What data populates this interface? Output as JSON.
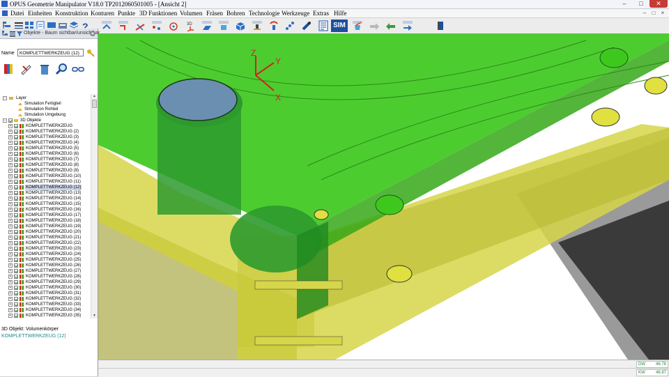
{
  "window": {
    "title": "OPUS Geometrie Manipulator V18.0   TP2012060501005   - [Ansicht 2]",
    "controls": [
      "–",
      "□",
      "✕"
    ]
  },
  "menu": {
    "items": [
      "Datei",
      "Einheiten",
      "Konstruktion",
      "Konturen",
      "Punkte",
      "3D Funktionen",
      "Volumen",
      "Fräsen",
      "Bohren",
      "Technologie",
      "Werkzeuge",
      "Extras",
      "Hilfe"
    ],
    "mdi_controls": [
      "–",
      "□",
      "×"
    ]
  },
  "toolbar": {
    "sim_label": "SIM"
  },
  "panel": {
    "header": "Objekte - Baum sichtbar/unsichtbar",
    "name_label": "Name",
    "name_value": "KOMPLETTWERKZEUG (12)"
  },
  "tree": {
    "layer_root": "Layer",
    "layers": [
      "Simulation Fertigteil",
      "Simulation Rohteil",
      "Simulation Umgebung"
    ],
    "objects_root": "3D Objekte",
    "items": [
      "KOMPLETTWERKZEUG",
      "KOMPLETTWERKZEUG (2)",
      "KOMPLETTWERKZEUG (3)",
      "KOMPLETTWERKZEUG (4)",
      "KOMPLETTWERKZEUG (5)",
      "KOMPLETTWERKZEUG (6)",
      "KOMPLETTWERKZEUG (7)",
      "KOMPLETTWERKZEUG (8)",
      "KOMPLETTWERKZEUG (9)",
      "KOMPLETTWERKZEUG (10)",
      "KOMPLETTWERKZEUG (11)",
      "KOMPLETTWERKZEUG (12)",
      "KOMPLETTWERKZEUG (13)",
      "KOMPLETTWERKZEUG (14)",
      "KOMPLETTWERKZEUG (15)",
      "KOMPLETTWERKZEUG (16)",
      "KOMPLETTWERKZEUG (17)",
      "KOMPLETTWERKZEUG (18)",
      "KOMPLETTWERKZEUG (19)",
      "KOMPLETTWERKZEUG (20)",
      "KOMPLETTWERKZEUG (21)",
      "KOMPLETTWERKZEUG (22)",
      "KOMPLETTWERKZEUG (23)",
      "KOMPLETTWERKZEUG (24)",
      "KOMPLETTWERKZEUG (25)",
      "KOMPLETTWERKZEUG (26)",
      "KOMPLETTWERKZEUG (27)",
      "KOMPLETTWERKZEUG (28)",
      "KOMPLETTWERKZEUG (29)",
      "KOMPLETTWERKZEUG (30)",
      "KOMPLETTWERKZEUG (31)",
      "KOMPLETTWERKZEUG (32)",
      "KOMPLETTWERKZEUG (33)",
      "KOMPLETTWERKZEUG (34)",
      "KOMPLETTWERKZEUG (35)"
    ],
    "selected": "KOMPLETTWERKZEUG (12)"
  },
  "info": {
    "line1": "3D Objekt: Volumenkörper",
    "line2": "KOMPLETTWERKZEUG (12)"
  },
  "viewport": {
    "axes": {
      "x": "X",
      "y": "Y",
      "z": "Z"
    }
  },
  "status": {
    "dw_label": "DW",
    "dw_value": "46.76",
    "kw_label": "KW",
    "kw_value": "48.87"
  },
  "colors": {
    "green_body": "#3ec81e",
    "yellow_body": "#d6d64a",
    "grey_floor": "#888888",
    "axis_red": "#d42020",
    "selection": "#c9d5e8"
  }
}
